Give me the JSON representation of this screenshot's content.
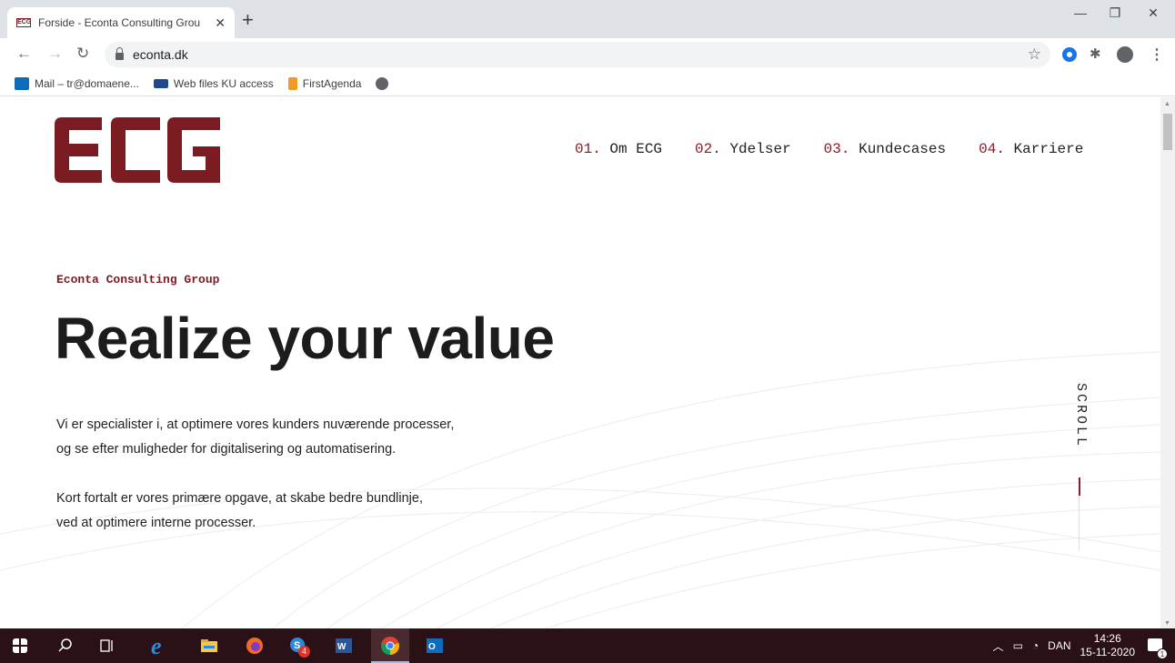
{
  "browser": {
    "tab_title": "Forside - Econta Consulting Grou",
    "tab_favicon": "ECG",
    "url": "econta.dk",
    "new_tab": "+",
    "window_controls": {
      "minimize": "—",
      "restore": "❐",
      "close": "✕"
    }
  },
  "bookmarks": [
    {
      "label": "Mail – tr@domaene...",
      "icon": "outlook-icon"
    },
    {
      "label": "Web files KU access",
      "icon": "ku-icon"
    },
    {
      "label": "FirstAgenda",
      "icon": "firstagenda-icon"
    },
    {
      "label": "",
      "icon": "globe-icon"
    }
  ],
  "site": {
    "logo_text": "ECG",
    "brand_color": "#7b1c22",
    "nav": [
      {
        "num": "01.",
        "label": "Om ECG"
      },
      {
        "num": "02.",
        "label": "Ydelser"
      },
      {
        "num": "03.",
        "label": "Kundecases"
      },
      {
        "num": "04.",
        "label": "Karriere"
      }
    ],
    "eyebrow": "Econta Consulting Group",
    "headline": "Realize your value",
    "paragraph1": [
      "Vi er specialister i, at optimere vores kunders nuværende processer,",
      "og se efter muligheder for digitalisering og automatisering."
    ],
    "paragraph2": [
      "Kort fortalt er vores primære opgave, at skabe bedre bundlinje,",
      "ved at optimere interne processer."
    ],
    "scroll_label": "SCROLL"
  },
  "taskbar": {
    "apps": [
      "windows-start-icon",
      "search-icon",
      "task-view-icon",
      "edge-icon",
      "file-explorer-icon",
      "firefox-icon",
      "skype-icon",
      "word-icon",
      "chrome-icon",
      "outlook-icon"
    ],
    "skype_badge": "4",
    "language": "DAN",
    "time": "14:26",
    "date": "15-11-2020",
    "notification_count": "1"
  }
}
